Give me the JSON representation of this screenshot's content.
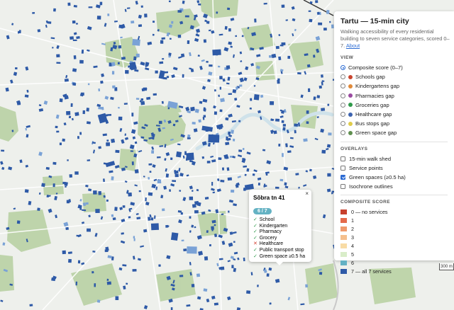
{
  "panel": {
    "title": "Tartu — 15-min city",
    "subtitle": "Walking accessibility of every residential building to seven service categories, scored 0–7.",
    "about_link": "About",
    "view_heading": "VIEW",
    "view_options": [
      {
        "label": "Composite score (0–7)",
        "selected": true,
        "color": ""
      },
      {
        "label": "Schools gap",
        "selected": false,
        "color": "#c9452e"
      },
      {
        "label": "Kindergartens gap",
        "selected": false,
        "color": "#e08a3a"
      },
      {
        "label": "Pharmacies gap",
        "selected": false,
        "color": "#9a4aa0"
      },
      {
        "label": "Groceries gap",
        "selected": false,
        "color": "#2f9a4a"
      },
      {
        "label": "Healthcare gap",
        "selected": false,
        "color": "#3d64b0"
      },
      {
        "label": "Bus stops gap",
        "selected": false,
        "color": "#e0cc4a"
      },
      {
        "label": "Green space gap",
        "selected": false,
        "color": "#5f8f4f"
      }
    ],
    "overlays_heading": "OVERLAYS",
    "overlays": [
      {
        "label": "15-min walk shed",
        "checked": false
      },
      {
        "label": "Service points",
        "checked": false
      },
      {
        "label": "Green spaces (≥0.5 ha)",
        "checked": true
      },
      {
        "label": "Isochrone outlines",
        "checked": false
      }
    ],
    "legend_heading": "COMPOSITE SCORE",
    "legend": [
      {
        "label": "0 — no services",
        "color": "#c7402d"
      },
      {
        "label": "1",
        "color": "#e46a4b"
      },
      {
        "label": "2",
        "color": "#ef9a6d"
      },
      {
        "label": "3",
        "color": "#f5bf8d"
      },
      {
        "label": "4",
        "color": "#f8dca6"
      },
      {
        "label": "5",
        "color": "#d9edc9"
      },
      {
        "label": "6",
        "color": "#62b1c4"
      },
      {
        "label": "7 — all 7 services",
        "color": "#2e5aa7"
      }
    ]
  },
  "popup": {
    "address": "Sõbra tn 41",
    "score": "6 / 7",
    "close": "×",
    "items": [
      {
        "label": "School",
        "ok": true
      },
      {
        "label": "Kindergarten",
        "ok": true
      },
      {
        "label": "Pharmacy",
        "ok": true
      },
      {
        "label": "Grocery",
        "ok": true
      },
      {
        "label": "Healthcare",
        "ok": false
      },
      {
        "label": "Public transport stop",
        "ok": true
      },
      {
        "label": "Green space ≥0.5 ha",
        "ok": true
      }
    ]
  },
  "scale_bar": "300 m",
  "colors": {
    "building": "#2e5aa7",
    "building_light": "#7aa2d6",
    "green": "#bcd3a8",
    "river": "#cfe2ea",
    "map_bg": "#eef0ec",
    "accent": "#2a6ad3"
  }
}
